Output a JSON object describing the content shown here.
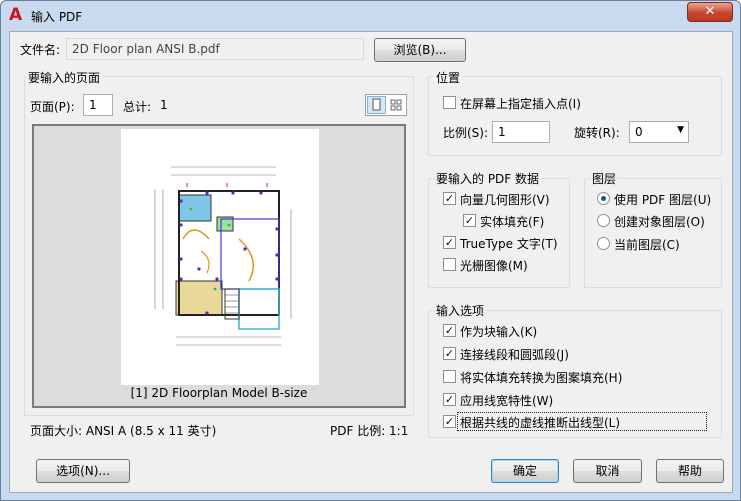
{
  "window": {
    "title": "输入 PDF",
    "close_glyph": "✕"
  },
  "file": {
    "label": "文件名:",
    "value": "2D Floor plan ANSI B.pdf",
    "browse": "浏览(B)..."
  },
  "pages": {
    "group_title": "要输入的页面",
    "page_label": "页面(P):",
    "page_value": "1",
    "total_label": "总计:",
    "total_value": "1",
    "caption": "[1] 2D Floorplan Model B-size",
    "size_text": "页面大小: ANSI A (8.5 x 11 英寸)",
    "scale_text": "PDF 比例: 1:1"
  },
  "position": {
    "group_title": "位置",
    "specify_on_screen": {
      "label": "在屏幕上指定插入点(I)",
      "checked": false
    },
    "scale_label": "比例(S):",
    "scale_value": "1",
    "rotation_label": "旋转(R):",
    "rotation_value": "0"
  },
  "pdf_data": {
    "group_title": "要输入的 PDF 数据",
    "items": [
      {
        "label": "向量几何图形(V)",
        "checked": true
      },
      {
        "label": "实体填充(F)",
        "checked": true
      },
      {
        "label": "TrueType 文字(T)",
        "checked": true
      },
      {
        "label": "光栅图像(M)",
        "checked": false
      }
    ]
  },
  "layers": {
    "group_title": "图层",
    "options": [
      {
        "label": "使用 PDF 图层(U)",
        "selected": true
      },
      {
        "label": "创建对象图层(O)",
        "selected": false
      },
      {
        "label": "当前图层(C)",
        "selected": false
      }
    ]
  },
  "import_options": {
    "group_title": "输入选项",
    "items": [
      {
        "label": "作为块输入(K)",
        "checked": true
      },
      {
        "label": "连接线段和圆弧段(J)",
        "checked": true
      },
      {
        "label": "将实体填充转换为图案填充(H)",
        "checked": false
      },
      {
        "label": "应用线宽特性(W)",
        "checked": true
      },
      {
        "label": "根据共线的虚线推断出线型(L)",
        "checked": true
      }
    ]
  },
  "buttons": {
    "options": "选项(N)...",
    "ok": "确定",
    "cancel": "取消",
    "help": "帮助"
  },
  "check_glyph": "✓",
  "colors": {
    "title_bar": "#c9daee",
    "client": "#f0f0f0",
    "app_icon": "#c8161d",
    "close": "#c9462d"
  }
}
